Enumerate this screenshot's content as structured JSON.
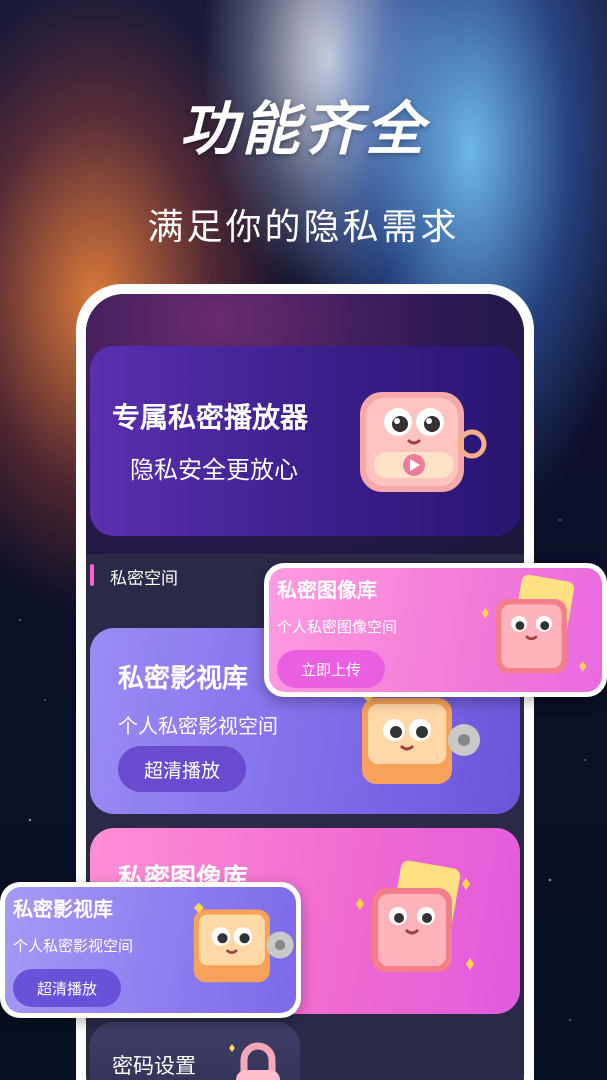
{
  "promo": {
    "headline": "功能齐全",
    "subheadline": "满足你的隐私需求"
  },
  "app": {
    "banner": {
      "title": "专属私密播放器",
      "subtitle": "隐私安全更放心"
    },
    "section": {
      "label": "私密空间"
    },
    "cards": [
      {
        "title": "私密影视库",
        "subtitle": "个人私密影视空间",
        "button": "超清播放"
      },
      {
        "title": "私密图像库",
        "subtitle": "",
        "button": ""
      },
      {
        "title": "密码设置"
      }
    ]
  },
  "popups": {
    "image_library": {
      "title": "私密图像库",
      "subtitle": "个人私密图像空间",
      "button": "立即上传"
    },
    "video_library": {
      "title": "私密影视库",
      "subtitle": "个人私密影视空间",
      "button": "超清播放"
    }
  },
  "colors": {
    "accent_pink": "#ff5fd0",
    "accent_purple": "#6a4bd0",
    "card_video": "#7d6ae8",
    "card_image": "#f06ad0"
  },
  "icons": [
    "player-mascot-icon",
    "video-mascot-icon",
    "image-mascot-icon",
    "lock-mascot-icon"
  ]
}
